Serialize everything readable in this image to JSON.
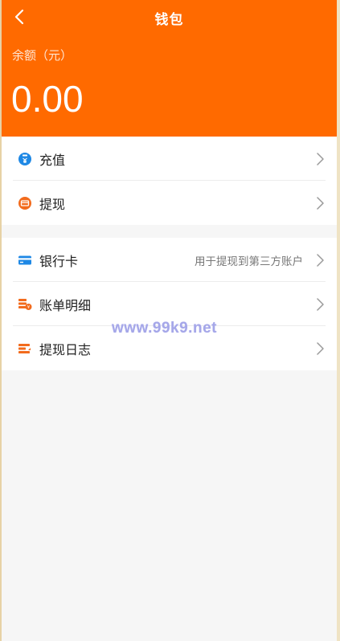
{
  "header": {
    "title": "钱包",
    "balance_label": "余额（元）",
    "balance_value": "0.00",
    "background_color": "#ff6a00"
  },
  "icons": {
    "back": "chevron-left-icon",
    "chevron": "chevron-right-icon"
  },
  "menu_group_1": [
    {
      "label": "充值",
      "icon": "recharge-icon",
      "icon_color": "#1e88e5"
    },
    {
      "label": "提现",
      "icon": "withdraw-icon",
      "icon_color": "#ff6a00"
    }
  ],
  "menu_group_2": [
    {
      "label": "银行卡",
      "hint": "用于提现到第三方账户",
      "icon": "bank-card-icon",
      "icon_color": "#1e88e5"
    },
    {
      "label": "账单明细",
      "icon": "bill-detail-icon",
      "icon_color": "#ff6a00"
    },
    {
      "label": "提现日志",
      "icon": "withdraw-log-icon",
      "icon_color": "#ff6a00"
    }
  ],
  "watermark": "www.99k9.net"
}
